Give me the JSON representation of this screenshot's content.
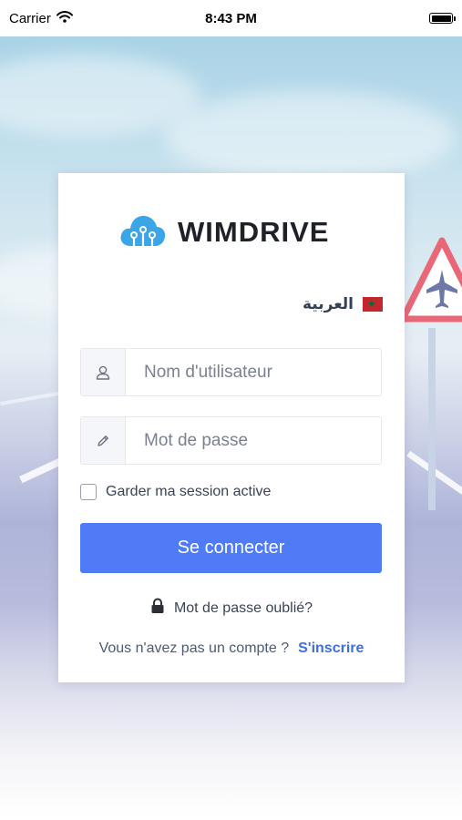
{
  "status_bar": {
    "carrier": "Carrier",
    "time": "8:43 PM"
  },
  "brand": {
    "name": "WIMDRIVE",
    "accent_color": "#4f7cf6"
  },
  "language": {
    "label": "العربية"
  },
  "login_form": {
    "username_placeholder": "Nom d'utilisateur",
    "password_placeholder": "Mot de passe",
    "remember_label": "Garder ma session active",
    "submit_label": "Se connecter",
    "forgot_label": "Mot de passe oublié?",
    "no_account_text": "Vous n'avez pas un compte ?",
    "signup_label": "S'inscrire"
  },
  "icons": {
    "username": "user-icon",
    "password": "pencil-icon",
    "forgot": "lock-icon",
    "wifi": "wifi-icon",
    "battery": "battery-icon",
    "logo": "cloud-logo-icon",
    "flag": "morocco-flag-icon"
  }
}
